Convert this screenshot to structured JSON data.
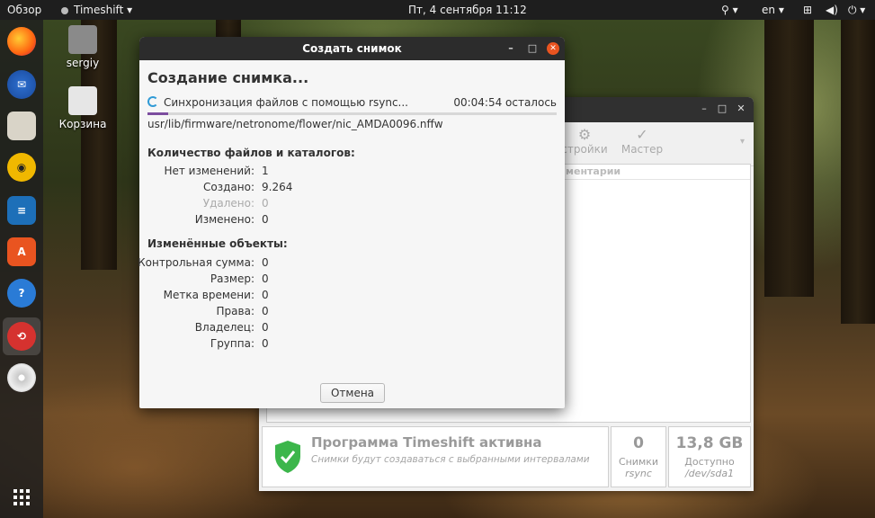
{
  "topbar": {
    "activities": "Обзор",
    "app_name": "Timeshift",
    "datetime": "Пт, 4 сентября  11:12",
    "language": "en"
  },
  "desktop": {
    "icons": [
      {
        "label": "sergiy",
        "icon": "home-folder-icon"
      },
      {
        "label": "Корзина",
        "icon": "trash-icon"
      }
    ]
  },
  "dock": {
    "items": [
      "firefox-icon",
      "thunderbird-icon",
      "files-icon",
      "rhythmbox-icon",
      "writer-icon",
      "software-icon",
      "help-icon",
      "timeshift-icon",
      "disc-icon",
      "apps-grid-icon"
    ]
  },
  "dialog": {
    "title": "Создать снимок",
    "heading": "Создание снимка...",
    "sync_text": "Синхронизация файлов с помощью rsync...",
    "time_left": "00:04:54 осталось",
    "progress": 0.05,
    "current_file": "usr/lib/firmware/netronome/flower/nic_AMDA0096.nffw",
    "counts_title": "Количество файлов и каталогов:",
    "counts": [
      {
        "label": "Нет изменений:",
        "value": "1"
      },
      {
        "label": "Создано:",
        "value": "9.264"
      },
      {
        "label": "Удалено:",
        "value": "0"
      },
      {
        "label": "Изменено:",
        "value": "0"
      }
    ],
    "changed_title": "Изменённые объекты:",
    "changed": [
      {
        "label": "Контрольная сумма:",
        "value": "0"
      },
      {
        "label": "Размер:",
        "value": "0"
      },
      {
        "label": "Метка времени:",
        "value": "0"
      },
      {
        "label": "Права:",
        "value": "0"
      },
      {
        "label": "Владелец:",
        "value": "0"
      },
      {
        "label": "Группа:",
        "value": "0"
      }
    ],
    "cancel_label": "Отмена"
  },
  "main_window": {
    "toolbar_settings": "стройки",
    "toolbar_wizard": "Мастер",
    "column_comments": "ментарии",
    "status_title": "Программа Timeshift активна",
    "status_subtitle": "Снимки будут создаваться с выбранными интервалами",
    "snapshots_count": "0",
    "snapshots_label": "Снимки",
    "snapshots_sub": "rsync",
    "available_size": "13,8 GB",
    "available_label": "Доступно",
    "available_sub": "/dev/sda1"
  },
  "colors": {
    "accent": "#e95420",
    "progress": "#7c4d9f",
    "shield": "#3cb64b"
  }
}
